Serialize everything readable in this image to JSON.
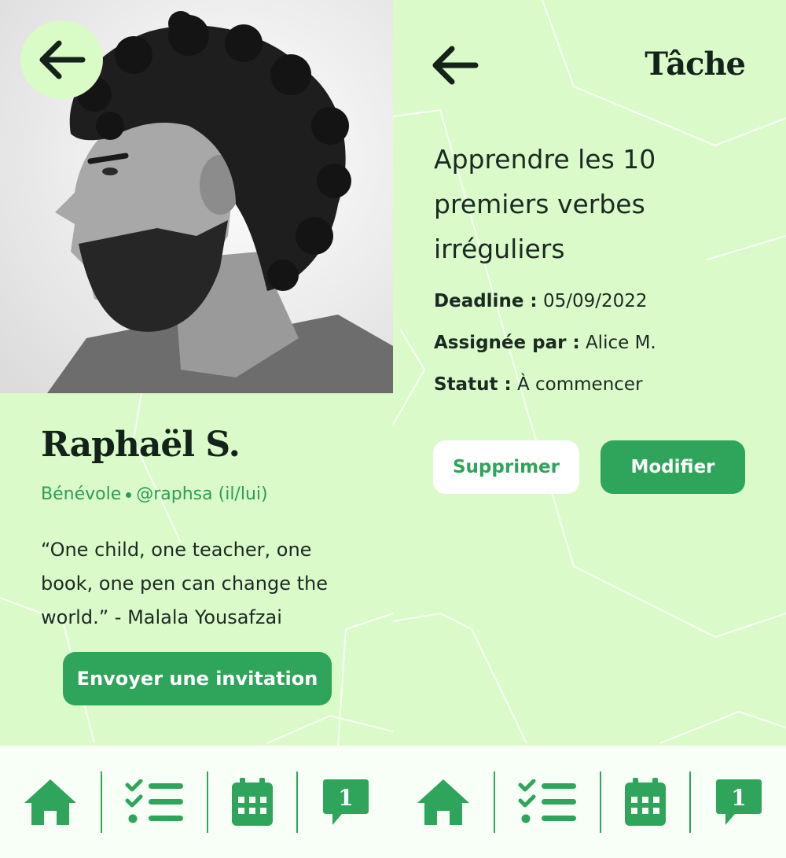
{
  "colors": {
    "background": "#dafbc9",
    "accent": "#2ea55a",
    "text": "#1b2a21",
    "white": "#ffffff"
  },
  "profile": {
    "back_icon": "arrow-left-icon",
    "photo": "portrait-photo",
    "name": "Raphaël S.",
    "role": "Bénévole",
    "handle": "@raphsa",
    "pronouns": "(il/lui)",
    "quote": "“One child, one teacher, one book, one pen can change the world.” - Malala Yousafzai",
    "invite_label": "Envoyer une invitation"
  },
  "task": {
    "back_icon": "arrow-left-icon",
    "page_title": "Tâche",
    "heading": "Apprendre les 10 premiers verbes irréguliers",
    "deadline_label": "Deadline :",
    "deadline_value": "05/09/2022",
    "assigned_label": "Assignée par :",
    "assigned_value": "Alice M.",
    "status_label": "Statut :",
    "status_value": "À commencer",
    "delete_label": "Supprimer",
    "edit_label": "Modifier"
  },
  "nav": {
    "items": [
      {
        "icon": "home-icon"
      },
      {
        "icon": "checklist-icon"
      },
      {
        "icon": "calendar-icon"
      },
      {
        "icon": "message-icon",
        "badge": "1"
      }
    ]
  }
}
